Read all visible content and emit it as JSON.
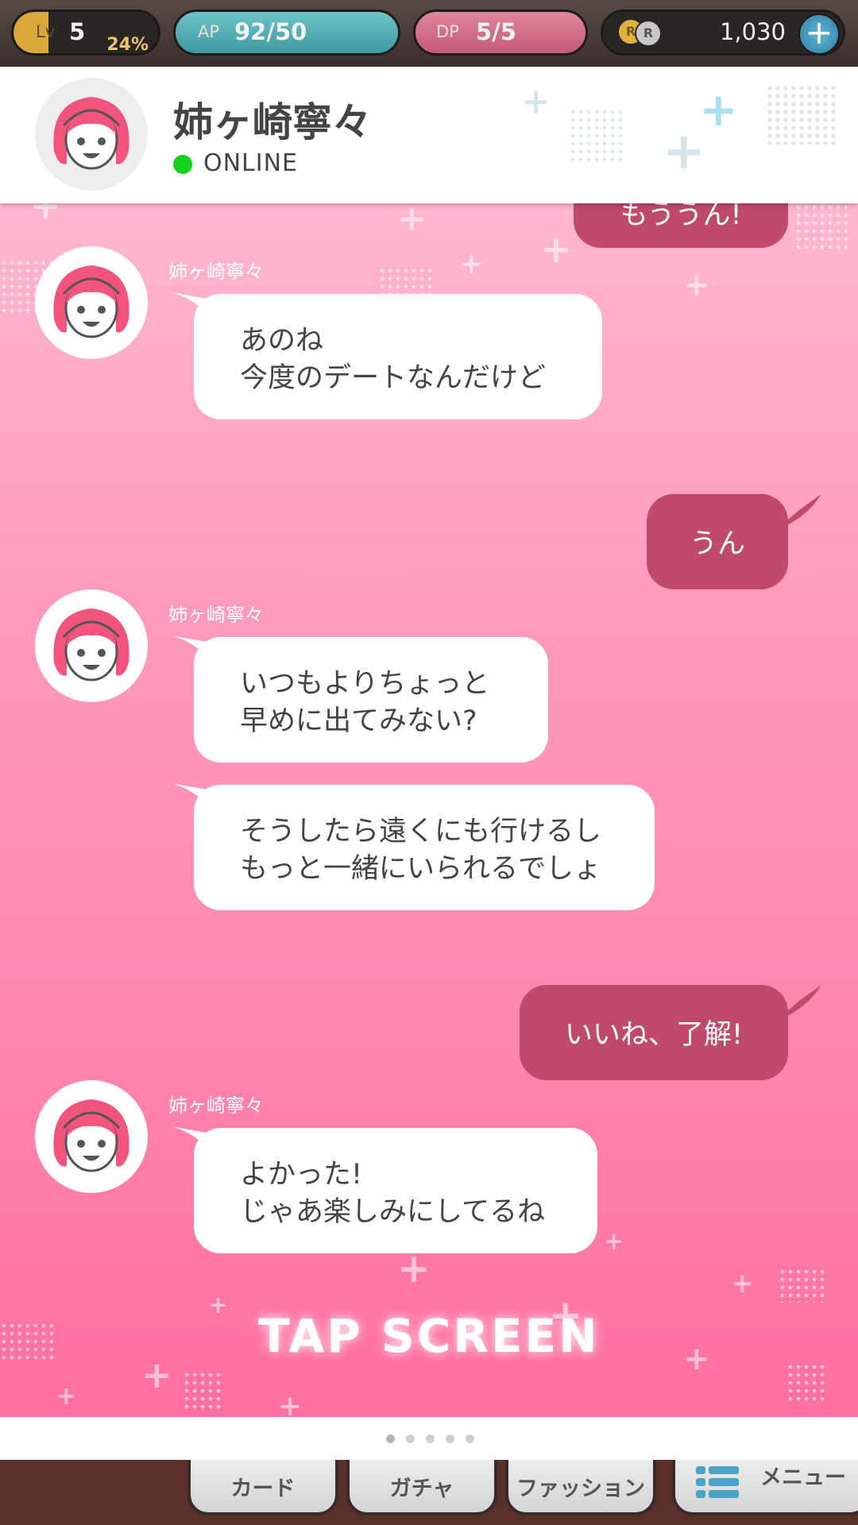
{
  "status_bar": {
    "level_label": "Lv",
    "level_value": "5",
    "level_progress_percent": 24,
    "level_progress_text": "24%",
    "ap_label": "AP",
    "ap_value": "92/50",
    "dp_label": "DP",
    "dp_value": "5/5",
    "coin_a_label": "R",
    "coin_b_label": "R",
    "money_value": "1,030",
    "add_button_label": "+"
  },
  "header": {
    "contact_name": "姉ヶ崎寧々",
    "status": "ONLINE",
    "status_color": "#13d21c"
  },
  "messages": [
    {
      "side": "right",
      "lines": [
        "もううん!"
      ],
      "partial": true
    },
    {
      "side": "left",
      "sender": "姉ヶ崎寧々",
      "lines": [
        "あのね",
        "今度のデートなんだけど"
      ]
    },
    {
      "side": "right",
      "lines": [
        "うん"
      ]
    },
    {
      "side": "left",
      "sender": "姉ヶ崎寧々",
      "lines": [
        "いつもよりちょっと",
        "早めに出てみない?"
      ]
    },
    {
      "side": "left",
      "lines": [
        "そうしたら遠くにも行けるし",
        "もっと一緒にいられるでしょ"
      ]
    },
    {
      "side": "right",
      "lines": [
        "いいね、了解!"
      ]
    },
    {
      "side": "left",
      "sender": "姉ヶ崎寧々",
      "lines": [
        "よかった!",
        "じゃあ楽しみにしてるね"
      ]
    }
  ],
  "tap_prompt": "TAP SCREEN",
  "pager": {
    "count": 5,
    "active": 0
  },
  "bottom_nav": [
    {
      "label": "カード"
    },
    {
      "label": "ガチャ"
    },
    {
      "label": "ファッション"
    },
    {
      "label": "メニュー"
    }
  ],
  "colors": {
    "my_bubble": "#c04a6c",
    "their_bubble": "#ffffff",
    "hair": "#f2547e"
  }
}
